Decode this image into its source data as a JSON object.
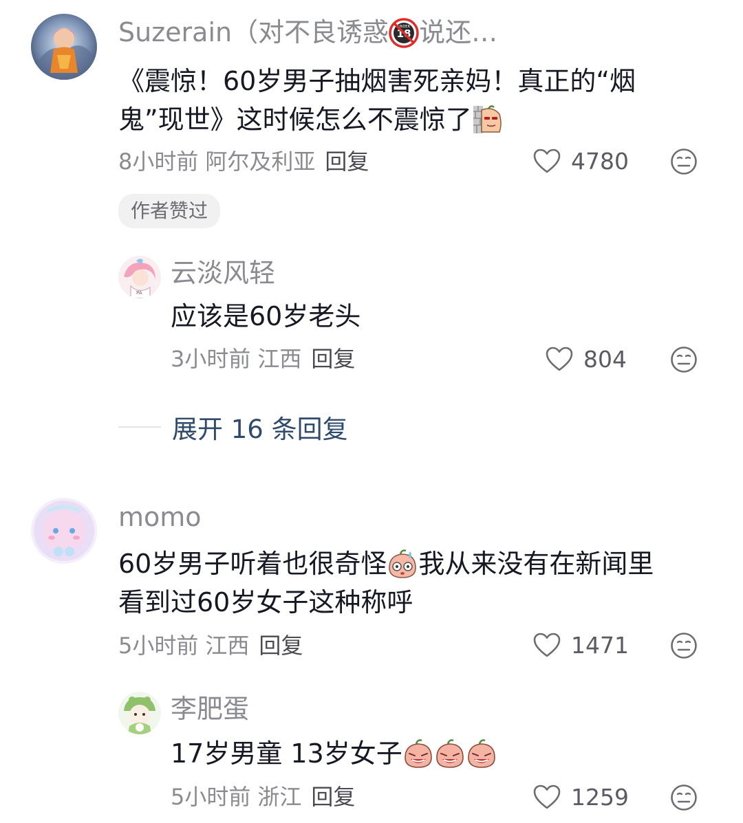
{
  "comments": [
    {
      "username": "Suzerain（对不良诱惑",
      "username_badge_icon": "under-18-icon",
      "username_tail": "说还…",
      "text_line1": "《震惊！60岁男子抽烟害死亲妈！真正的“烟",
      "text_line2": "鬼”现世》这时候怎么不震惊了",
      "sticker_icon": "peeking-sticker-icon",
      "time": "8小时前",
      "location": "阿尔及利亚",
      "reply_label": "回复",
      "likes": "4780",
      "badge": "作者赞过",
      "replies": [
        {
          "username": "云淡风轻",
          "text": "应该是60岁老头",
          "time": "3小时前",
          "location": "江西",
          "reply_label": "回复",
          "likes": "804"
        }
      ],
      "expand_label": "展开 16 条回复"
    },
    {
      "username": "momo",
      "text_line1_a": "60岁男子听着也很奇怪",
      "text_line1_b": "我从来没有在新闻里",
      "text_line2": "看到过60岁女子这种称呼",
      "sticker_icon": "sweating-sticker-icon",
      "time": "5小时前",
      "location": "江西",
      "reply_label": "回复",
      "likes": "1471",
      "replies": [
        {
          "username": "李肥蛋",
          "text": "17岁男童 13岁女子",
          "sticker_icons": [
            "crying-sticker-icon",
            "crying-sticker-icon",
            "crying-sticker-icon"
          ],
          "time": "5小时前",
          "location": "浙江",
          "reply_label": "回复",
          "likes": "1259"
        }
      ]
    }
  ]
}
